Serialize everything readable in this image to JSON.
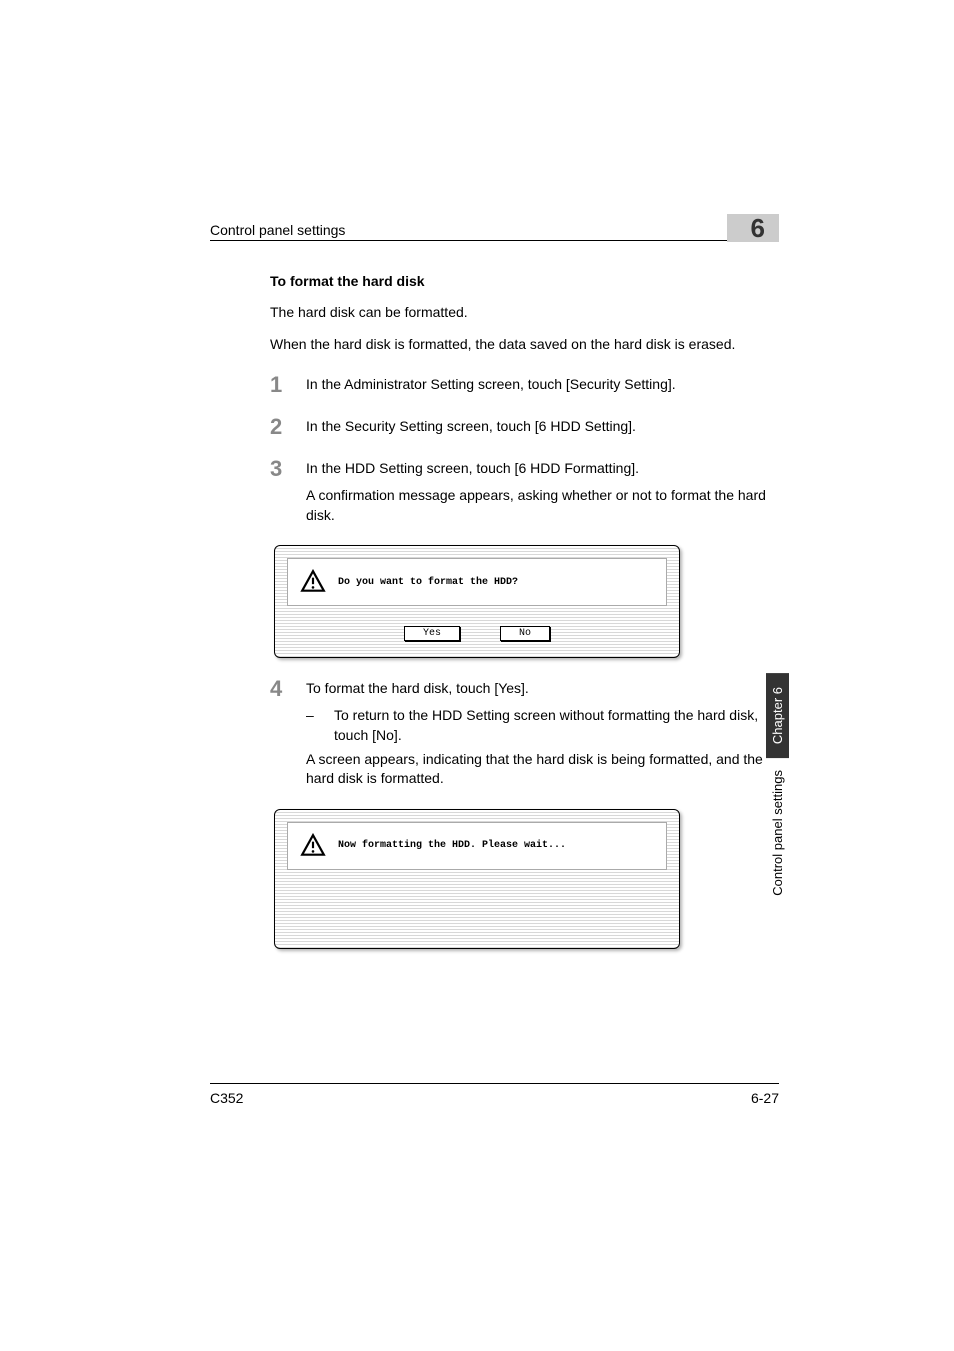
{
  "header": {
    "title": "Control panel settings",
    "chapter_number": "6"
  },
  "section": {
    "title": "To format the hard disk",
    "intro1": "The hard disk can be formatted.",
    "intro2": "When the hard disk is formatted, the data saved on the hard disk is erased."
  },
  "steps": [
    {
      "num": "1",
      "text": "In the Administrator Setting screen, touch [Security Setting]."
    },
    {
      "num": "2",
      "text": "In the Security Setting screen, touch [6 HDD Setting]."
    },
    {
      "num": "3",
      "text": "In the HDD Setting screen, touch [6 HDD Formatting].",
      "continue": "A confirmation message appears, asking whether or not to format the hard disk."
    },
    {
      "num": "4",
      "text": "To format the hard disk, touch [Yes].",
      "sub": "To return to the HDD Setting screen without formatting the hard disk, touch [No].",
      "continue": "A screen appears, indicating that the hard disk is being formatted, and the hard disk is formatted."
    }
  ],
  "dialog1": {
    "message": "Do you want to format the HDD?",
    "yes": "Yes",
    "no": "No"
  },
  "dialog2": {
    "message": "Now formatting the HDD. Please wait..."
  },
  "side": {
    "chapter": "Chapter 6",
    "section": "Control panel settings"
  },
  "footer": {
    "model": "C352",
    "page": "6-27"
  }
}
